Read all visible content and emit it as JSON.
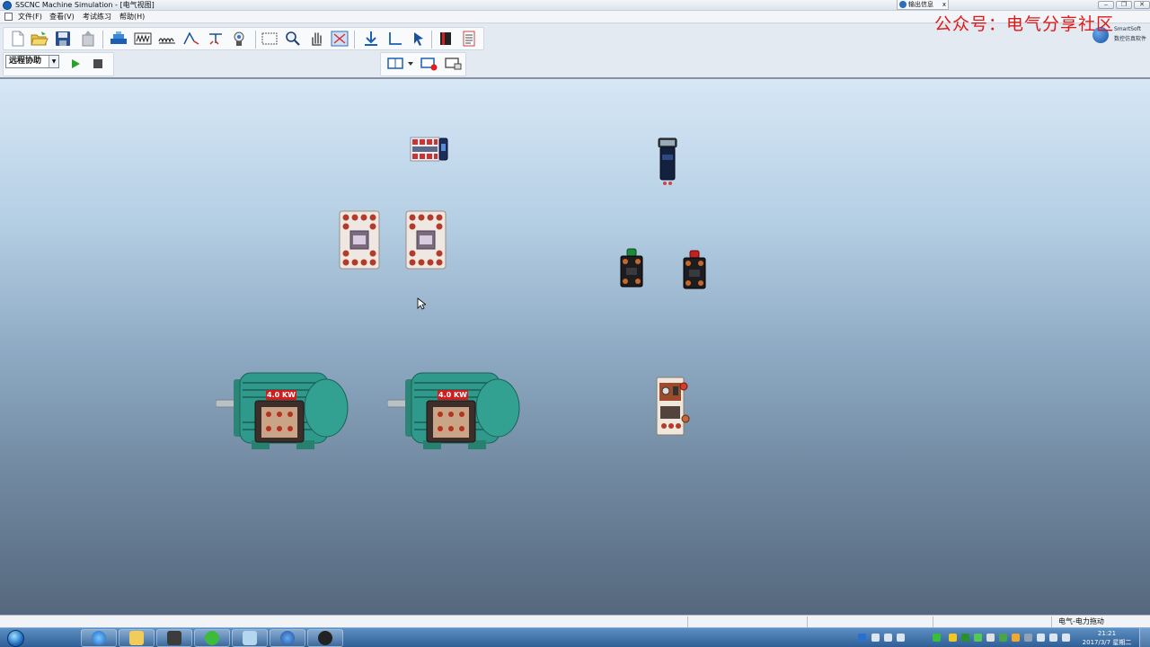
{
  "window": {
    "title": "SSCNC Machine Simulation - [电气视图]",
    "controls": [
      "‒",
      "❐",
      "✕"
    ]
  },
  "output_tab": {
    "label": "输出信息",
    "close": "x"
  },
  "menu": {
    "items": [
      "文件(F)",
      "查看(V)",
      "考试练习",
      "帮助(H)"
    ]
  },
  "toolbar": {
    "icons": [
      "new-file-icon",
      "open-folder-icon",
      "save-icon",
      "export-icon",
      "component-library-icon",
      "resistor-icon",
      "coil-icon",
      "wire-icon",
      "measure-icon",
      "probe-icon",
      "select-rectangle-icon",
      "zoom-icon",
      "pan-hand-icon",
      "fit-view-icon",
      "download-icon",
      "angle-icon",
      "pointer-icon",
      "book-icon",
      "list-icon"
    ],
    "mode_select": {
      "value": "远程协助"
    },
    "sim_controls": [
      "run-icon",
      "stop-icon"
    ],
    "view_icons": [
      "view-layout-icon",
      "view-record-icon",
      "view-window-icon"
    ]
  },
  "brand": {
    "line1": "SmartSoft",
    "line2": "数控仿真软件"
  },
  "watermark": "公众号：电气分享社区",
  "canvas": {
    "components": [
      {
        "name": "circuit-breaker",
        "type": "miniature circuit breaker"
      },
      {
        "name": "contactor-1",
        "type": "AC contactor"
      },
      {
        "name": "contactor-2",
        "type": "AC contactor"
      },
      {
        "name": "pilot-lamp",
        "type": "indicator lamp"
      },
      {
        "name": "push-button-start",
        "type": "push button (green)"
      },
      {
        "name": "push-button-stop",
        "type": "push button (red)"
      },
      {
        "name": "thermal-relay",
        "type": "thermal overload relay"
      },
      {
        "name": "motor-1",
        "type": "three-phase motor",
        "rating": "4.0 KW"
      },
      {
        "name": "motor-2",
        "type": "three-phase motor",
        "rating": "4.0 KW"
      }
    ],
    "colors": {
      "motor_body": "#2f9a8b",
      "background_top": "#d6e7f6",
      "background_bottom": "#55687d"
    }
  },
  "statusbar": {
    "text": "电气-电力拖动"
  },
  "taskbar": {
    "apps": [
      "ie-icon",
      "folder-icon",
      "media-icon",
      "wechat-icon",
      "notepad-icon",
      "sscnc-icon",
      "flash-icon"
    ],
    "clock_time": "21:21",
    "clock_date": "2017/3/7 星期二"
  }
}
